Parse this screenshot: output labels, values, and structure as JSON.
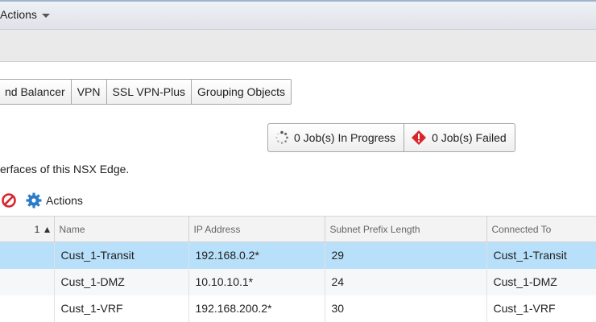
{
  "header": {
    "actions_label": "Actions"
  },
  "tabs": [
    "nd Balancer",
    "VPN",
    "SSL VPN-Plus",
    "Grouping Objects"
  ],
  "jobs": {
    "in_progress": "0 Job(s) In Progress",
    "failed": "0 Job(s) Failed"
  },
  "description": "erfaces of this NSX Edge.",
  "grid_toolbar": {
    "actions_label": "Actions"
  },
  "table": {
    "sort_indicator": "1 ▲",
    "columns": [
      "Name",
      "IP Address",
      "Subnet Prefix Length",
      "Connected To"
    ],
    "rows": [
      {
        "name": "Cust_1-Transit",
        "ip": "192.168.0.2*",
        "prefix": "29",
        "connected": "Cust_1-Transit",
        "selected": true
      },
      {
        "name": "Cust_1-DMZ",
        "ip": "10.10.10.1*",
        "prefix": "24",
        "connected": "Cust_1-DMZ",
        "selected": false
      },
      {
        "name": "Cust_1-VRF",
        "ip": "192.168.200.2*",
        "prefix": "30",
        "connected": "Cust_1-VRF",
        "selected": false
      }
    ]
  },
  "colors": {
    "selected_row": "#b8e0fa",
    "error_red": "#d9262c",
    "gear_blue": "#2a7bc8"
  },
  "icons": {
    "header_actions": "chevron-down-icon",
    "in_progress": "spinner-icon",
    "failed": "error-diamond-icon",
    "grid_delete": "no-entry-icon",
    "grid_actions": "gear-icon"
  }
}
